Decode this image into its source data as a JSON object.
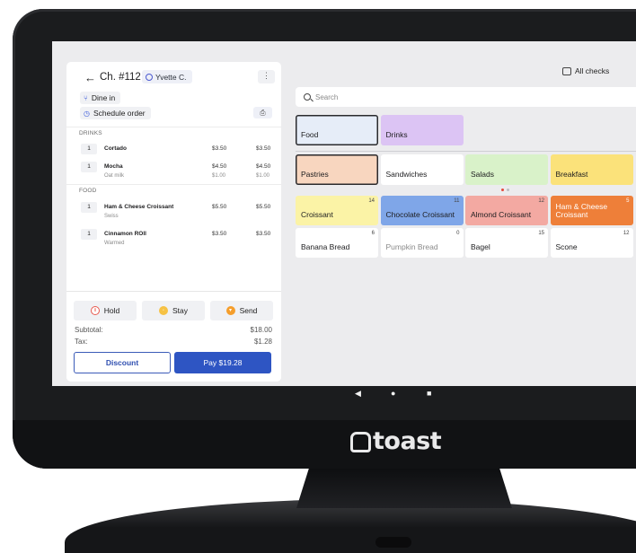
{
  "brand": {
    "logo_text": "toast"
  },
  "android_nav": {
    "back": "◀",
    "home": "●",
    "recents": "■"
  },
  "check": {
    "back_icon": "←",
    "title": "Ch. #112",
    "guest_name": "Yvette C.",
    "more_icon": "⋮",
    "order_type": "Dine in",
    "schedule": "Schedule order",
    "sections": [
      {
        "label": "DRINKS",
        "items": [
          {
            "qty": "1",
            "name": "Cortado",
            "unit": "$3.50",
            "total": "$3.50",
            "mod": "",
            "mod_unit": "",
            "mod_total": ""
          },
          {
            "qty": "1",
            "name": "Mocha",
            "unit": "$4.50",
            "total": "$4.50",
            "mod": "Oat milk",
            "mod_unit": "$1.00",
            "mod_total": "$1.00"
          }
        ]
      },
      {
        "label": "FOOD",
        "items": [
          {
            "qty": "1",
            "name": "Ham & Cheese Croissant",
            "unit": "$5.50",
            "total": "$5.50",
            "mod": "Swiss",
            "mod_unit": "",
            "mod_total": ""
          },
          {
            "qty": "1",
            "name": "Cinnamon ROll",
            "unit": "$3.50",
            "total": "$3.50",
            "mod": "Warmed",
            "mod_unit": "",
            "mod_total": ""
          }
        ]
      }
    ],
    "actions": {
      "hold": "Hold",
      "stay": "Stay",
      "send": "Send"
    },
    "subtotal_label": "Subtotal:",
    "subtotal_value": "$18.00",
    "tax_label": "Tax:",
    "tax_value": "$1.28",
    "discount_label": "Discount",
    "pay_label": "Pay $19.28"
  },
  "menu": {
    "all_checks_label": "All checks",
    "search_placeholder": "Search",
    "groups": [
      {
        "label": "Food",
        "color": "#e6edf8",
        "selected": true
      },
      {
        "label": "Drinks",
        "color": "#dcc4f4",
        "selected": false
      }
    ],
    "categories": [
      {
        "label": "Pastries",
        "color": "#f8d6bf",
        "selected": true
      },
      {
        "label": "Sandwiches",
        "color": "#ffffff",
        "selected": false
      },
      {
        "label": "Salads",
        "color": "#d9f2c9",
        "selected": false
      },
      {
        "label": "Breakfast",
        "color": "#fbe27a",
        "selected": false
      }
    ],
    "items": [
      {
        "label": "Croissant",
        "count": "14",
        "color": "#fbf3a6",
        "text": "#1d1d1f"
      },
      {
        "label": "Chocolate Croissant",
        "count": "11",
        "color": "#7fa6e8",
        "text": "#1d1d1f"
      },
      {
        "label": "Almond Croissant",
        "count": "12",
        "color": "#f3a9a2",
        "text": "#1d1d1f"
      },
      {
        "label": "Ham & Cheese\nCroissant",
        "count": "5",
        "color": "#ee7f39",
        "text": "#ffffff"
      },
      {
        "label": "Banana Bread",
        "count": "6",
        "color": "#ffffff",
        "text": "#1d1d1f"
      },
      {
        "label": "Pumpkin Bread",
        "count": "0",
        "color": "#ffffff",
        "text": "#8a8a8a"
      },
      {
        "label": "Bagel",
        "count": "15",
        "color": "#ffffff",
        "text": "#1d1d1f"
      },
      {
        "label": "Scone",
        "count": "12",
        "color": "#ffffff",
        "text": "#1d1d1f"
      }
    ],
    "page_dots": 2
  }
}
